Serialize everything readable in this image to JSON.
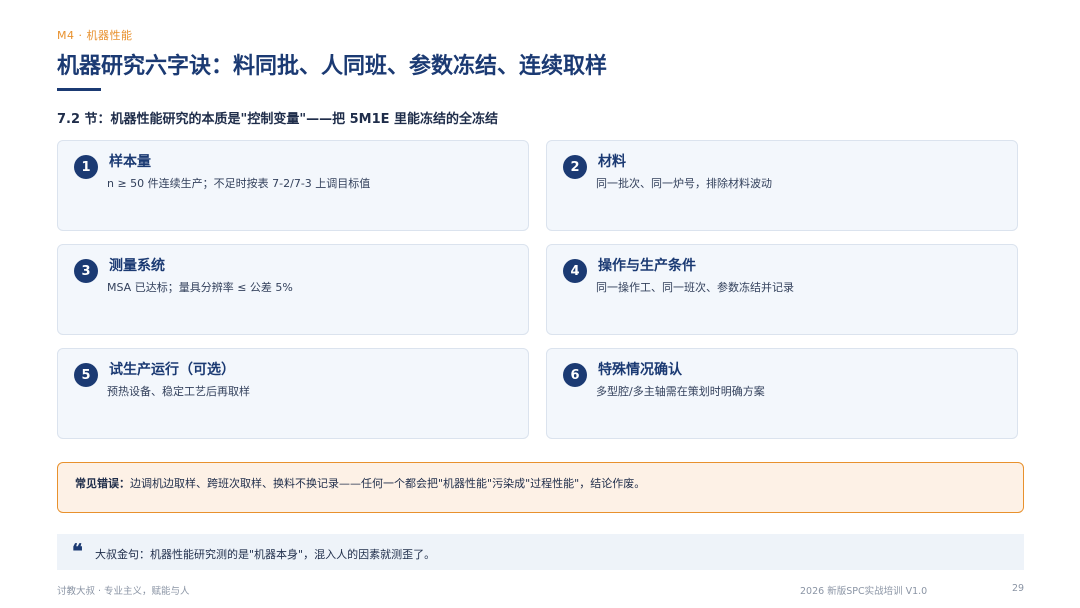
{
  "header": {
    "section_tag": "M4 · 机器性能",
    "title": "机器研究六字诀：料同批、人同班、参数冻结、连续取样",
    "subtitle": "7.2 节：机器性能研究的本质是\"控制变量\"——把 5M1E 里能冻结的全冻结"
  },
  "cards": [
    {
      "num": "1",
      "title": "样本量",
      "desc": "n ≥ 50 件连续生产；不足时按表 7-2/7-3 上调目标值"
    },
    {
      "num": "2",
      "title": "材料",
      "desc": "同一批次、同一炉号，排除材料波动"
    },
    {
      "num": "3",
      "title": "测量系统",
      "desc": "MSA 已达标；量具分辨率 ≤ 公差 5%"
    },
    {
      "num": "4",
      "title": "操作与生产条件",
      "desc": "同一操作工、同一班次、参数冻结并记录"
    },
    {
      "num": "5",
      "title": "试生产运行（可选）",
      "desc": "预热设备、稳定工艺后再取样"
    },
    {
      "num": "6",
      "title": "特殊情况确认",
      "desc": "多型腔/多主轴需在策划时明确方案"
    }
  ],
  "warning": {
    "label": "常见错误：",
    "text": "边调机边取样、跨班次取样、换料不换记录——任何一个都会把\"机器性能\"污染成\"过程性能\"，结论作废。"
  },
  "quote": {
    "icon": "❝",
    "label": "大叔金句：",
    "text": "机器性能研究测的是\"机器本身\"，混入人的因素就测歪了。"
  },
  "footer": {
    "left": "讨教大叔 · 专业主义，赋能与人",
    "right": "2026 新版SPC实战培训 V1.0",
    "page": "29"
  },
  "colors": {
    "primary": "#1b3a73",
    "accent": "#e8912d",
    "card_bg": "#f3f7fc",
    "warning_bg": "#fdf1e6",
    "quote_bg": "#eef3f9"
  }
}
